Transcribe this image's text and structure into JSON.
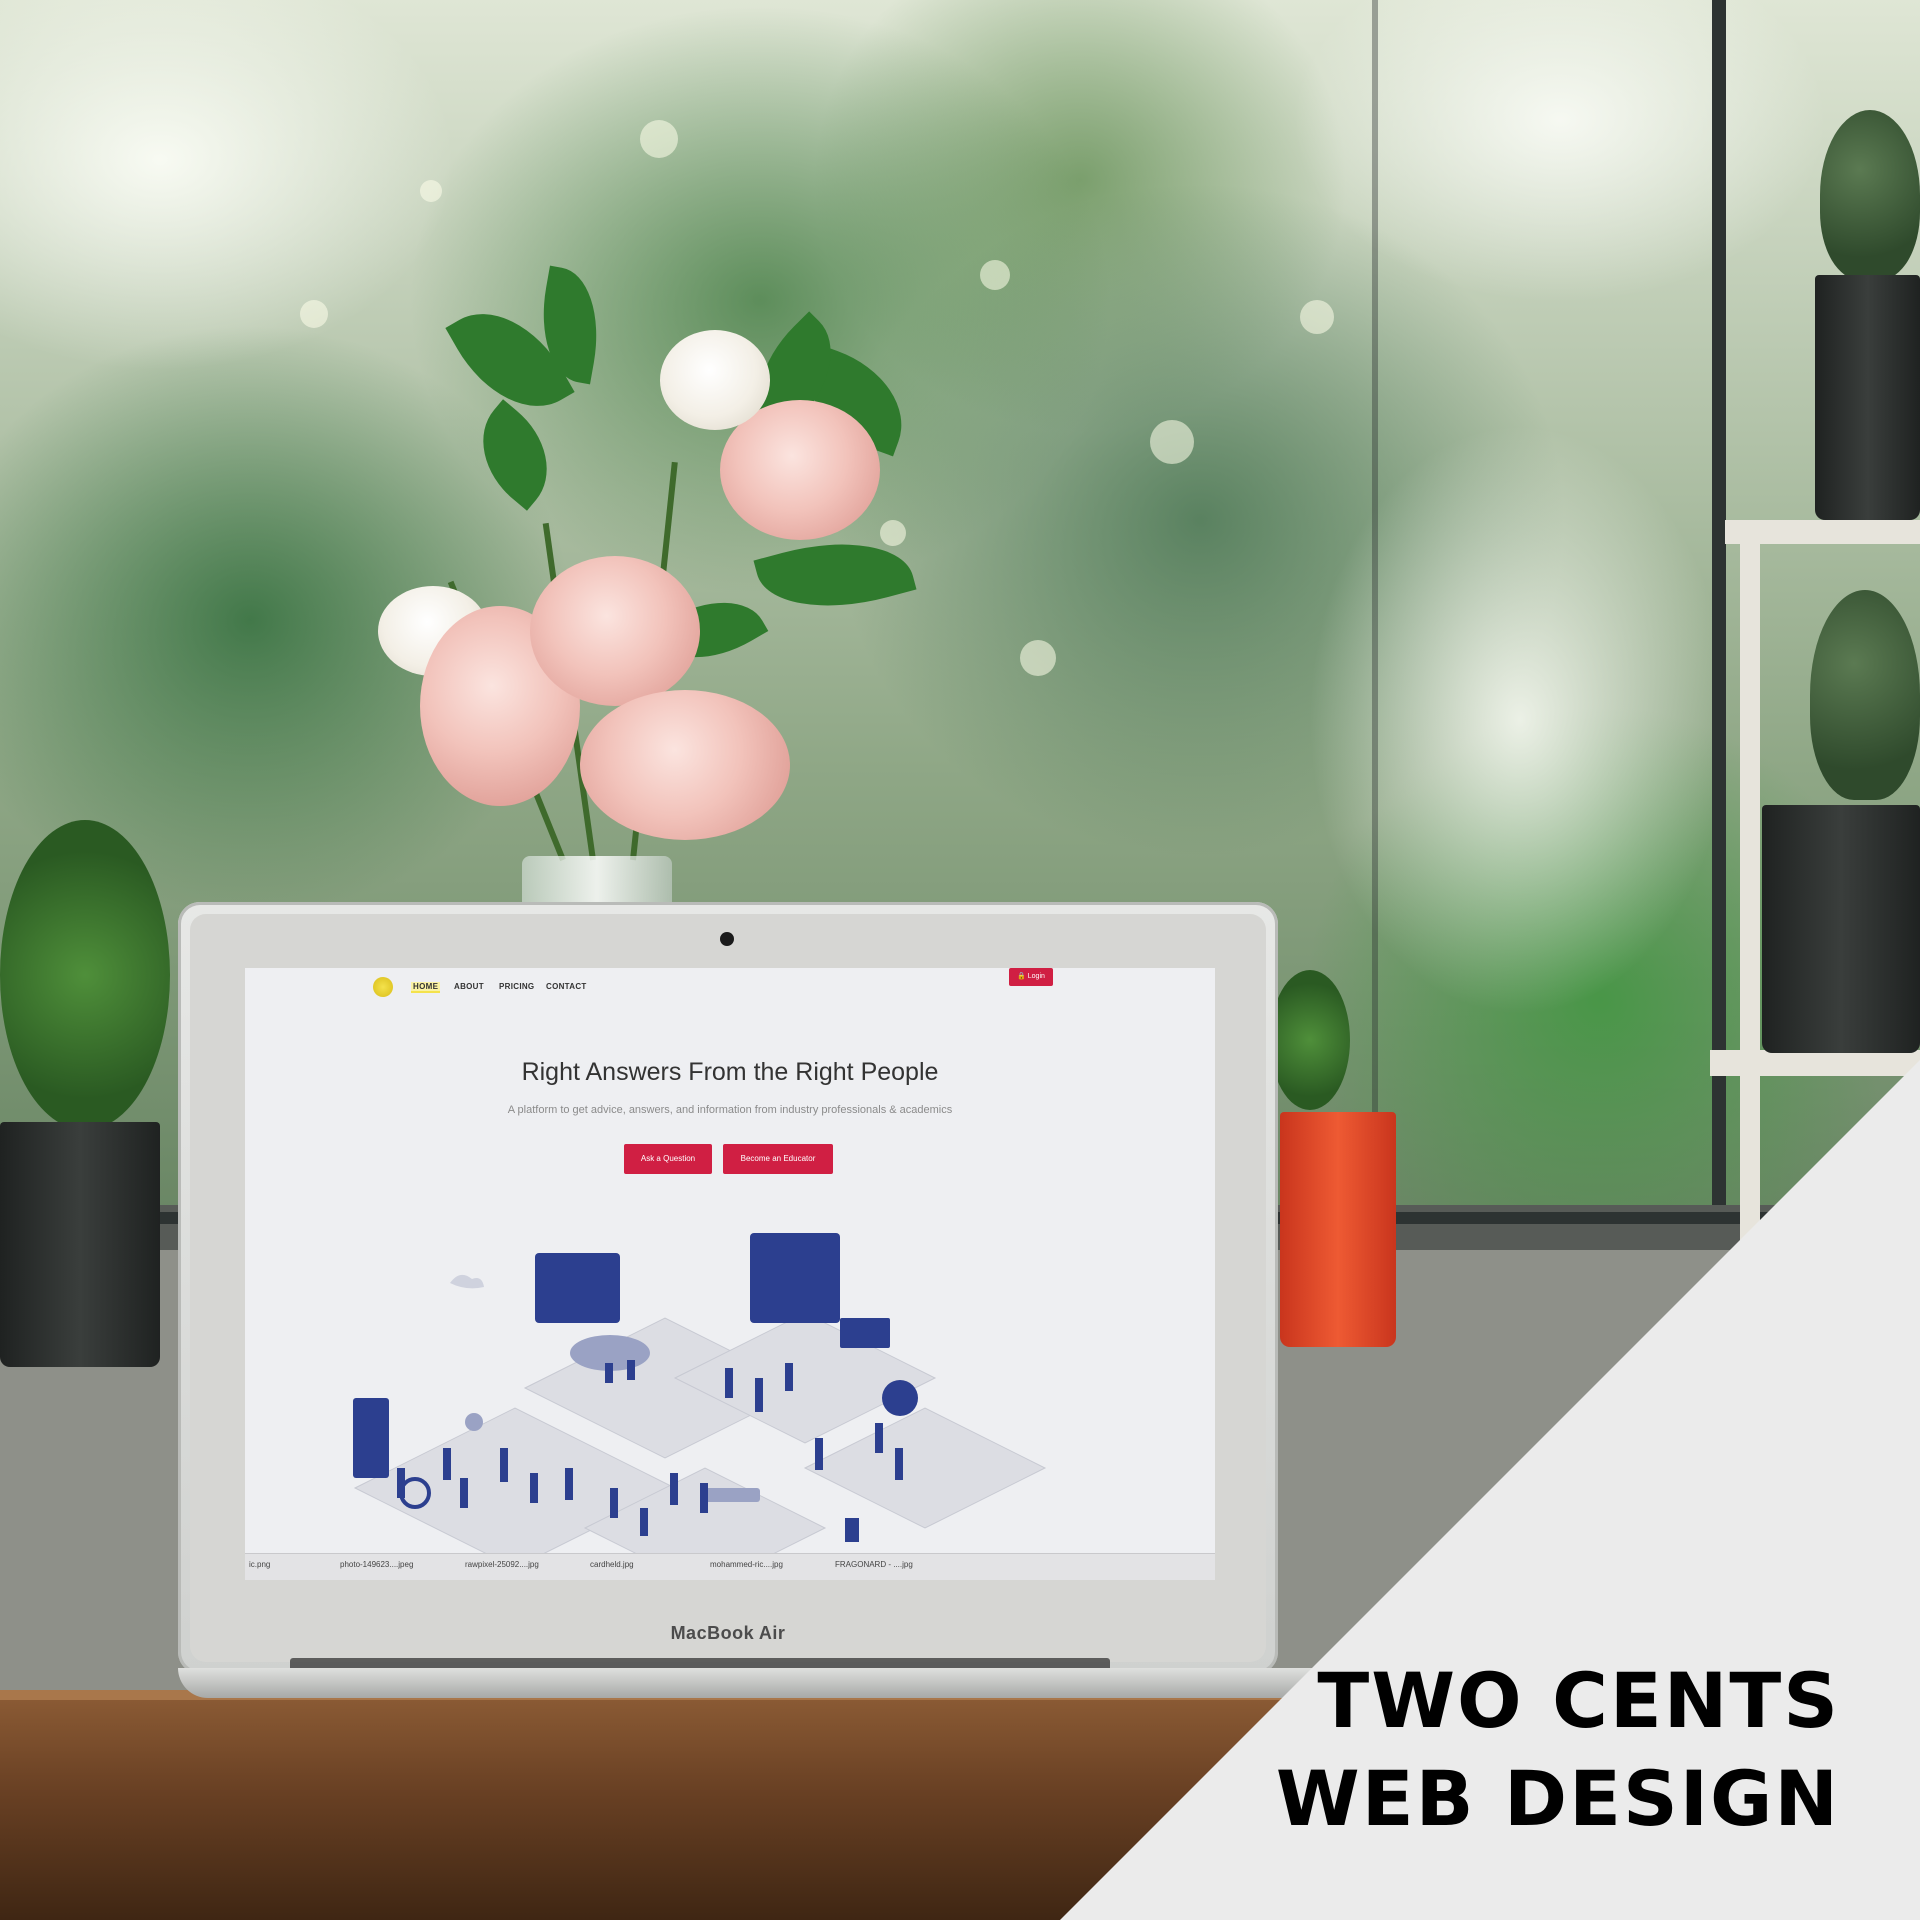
{
  "overlay": {
    "line1": "TWO CENTS",
    "line2": "WEB DESIGN",
    "triangle_color": "#ebebeb"
  },
  "laptop": {
    "brand": "MacBook Air"
  },
  "website": {
    "nav": {
      "items": [
        "HOME",
        "ABOUT",
        "PRICING",
        "CONTACT"
      ],
      "active": "HOME",
      "login_label": "Login"
    },
    "hero": {
      "title": "Right Answers From the Right People",
      "subtitle": "A platform to get advice, answers, and information from industry professionals & academics",
      "primary_button": "Ask a Question",
      "secondary_button": "Become an Educator"
    },
    "accent_color": "#d01f43",
    "illustration_color": "#2c3f8f"
  },
  "downloads_bar": {
    "files": [
      "ic.png",
      "photo-149623....jpeg",
      "rawpixel-25092....jpg",
      "cardheld.jpg",
      "mohammed-ric....jpg",
      "FRAGONARD - ....jpg"
    ]
  }
}
